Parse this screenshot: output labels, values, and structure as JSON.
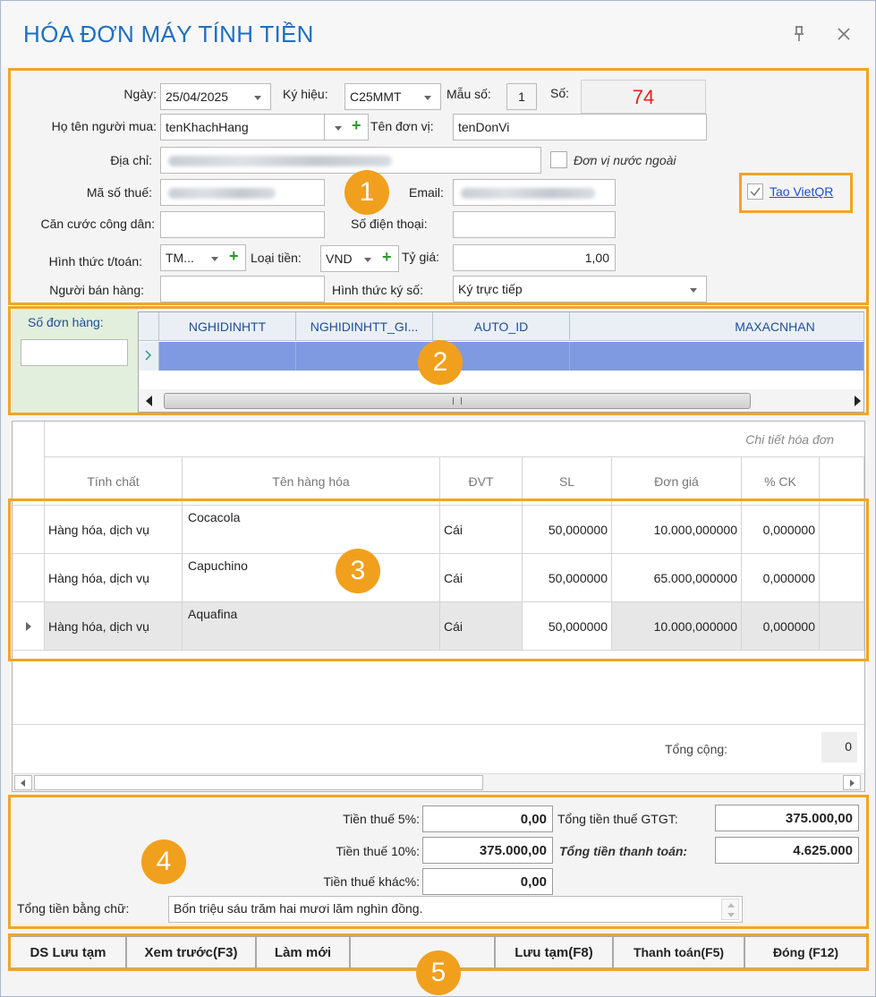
{
  "window": {
    "title": "HÓA ĐƠN MÁY TÍNH TIỀN"
  },
  "header": {
    "ngay_label": "Ngày:",
    "ngay_value": "25/04/2025",
    "kyhieu_label": "Ký hiệu:",
    "kyhieu_value": "C25MMT",
    "mauso_label": "Mẫu số:",
    "mauso_value": "1",
    "so_label": "Số:",
    "so_value": "74",
    "nguoimua_label": "Họ tên người mua:",
    "nguoimua_value": "tenKhachHang",
    "donvi_label": "Tên đơn vị:",
    "donvi_value": "tenDonVi",
    "diachi_label": "Địa chỉ:",
    "nuocngoai_label": "Đơn vị nước ngoài",
    "masothue_label": "Mã số thuế:",
    "email_label": "Email:",
    "vietqr_label": "Tao VietQR",
    "cccd_label": "Căn cước công dân:",
    "sdt_label": "Số điện thoại:",
    "httt_label": "Hình thức t/toán:",
    "httt_value": "TM...",
    "loaitien_label": "Loại tiền:",
    "loaitien_value": "VND",
    "tygia_label": "Tỷ giá:",
    "tygia_value": "1,00",
    "nguoiban_label": "Người bán hàng:",
    "htks_label": "Hình thức ký số:",
    "htks_value": "Ký trực tiếp"
  },
  "order": {
    "sodonhang_label": "Số đơn hàng:",
    "columns": [
      "NGHIDINHTT",
      "NGHIDINHTT_GI...",
      "AUTO_ID",
      "MAXACNHAN"
    ]
  },
  "detail": {
    "caption": "Chi tiết hóa đơn",
    "columns": [
      "Tính chất",
      "Tên hàng hóa",
      "ĐVT",
      "SL",
      "Đơn giá",
      "% CK"
    ],
    "rows": [
      {
        "tinhchat": "Hàng hóa, dịch vụ",
        "ten": "Cocacola",
        "dvt": "Cái",
        "sl": "50,000000",
        "dongia": "10.000,000000",
        "ck": "0,000000"
      },
      {
        "tinhchat": "Hàng hóa, dịch vụ",
        "ten": "Capuchino",
        "dvt": "Cái",
        "sl": "50,000000",
        "dongia": "65.000,000000",
        "ck": "0,000000"
      },
      {
        "tinhchat": "Hàng hóa, dịch vụ",
        "ten": "Aquafina",
        "dvt": "Cái",
        "sl": "50,000000",
        "dongia": "10.000,000000",
        "ck": "0,000000"
      }
    ],
    "tongcong_label": "Tổng cộng:",
    "tongcong_value": "0"
  },
  "summary": {
    "thue5_label": "Tiền thuế 5%:",
    "thue5_value": "0,00",
    "thue10_label": "Tiền thuế 10%:",
    "thue10_value": "375.000,00",
    "thuekhac_label": "Tiền thuế khác%:",
    "thuekhac_value": "0,00",
    "tongthue_label": "Tổng tiền thuế GTGT:",
    "tongthue_value": "375.000,00",
    "thanhtoan_label": "Tổng tiền thanh toán:",
    "thanhtoan_value": "4.625.000",
    "bangchu_label": "Tổng tiền bằng chữ:",
    "bangchu_value": "Bốn triệu sáu trăm hai mươi lăm nghìn đồng."
  },
  "buttons": {
    "dsluutam": "DS Lưu tạm",
    "xemtruoc": "Xem trước(F3)",
    "lammoi": "Làm mới",
    "luutam": "Lưu tạm(F8)",
    "thanhtoan": "Thanh toán(F5)",
    "dong": "Đóng (F12)"
  },
  "callouts": [
    "1",
    "2",
    "3",
    "4",
    "5"
  ],
  "colors": {
    "accent": "#1f6fc0",
    "highlight": "#f0a525",
    "number_red": "#e02020",
    "selection": "#7f9ae0"
  }
}
